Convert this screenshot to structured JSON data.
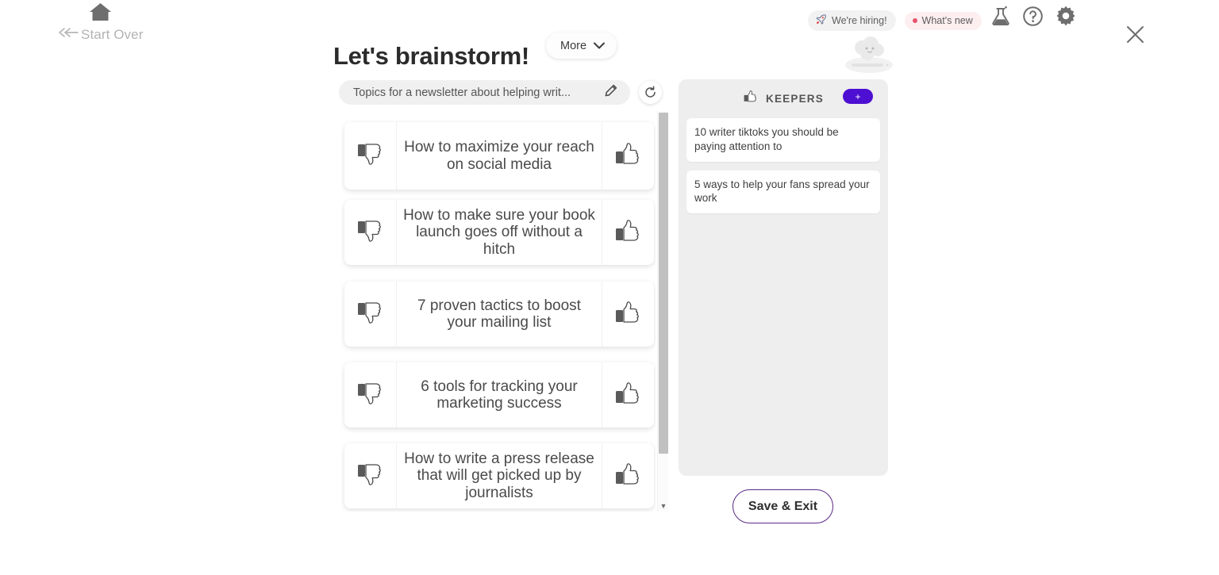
{
  "header": {
    "start_over_label": "Start Over",
    "home_icon": "home-icon",
    "back_icon": "double-chevron-left-icon",
    "badges": [
      {
        "label": "We're hiring!",
        "icon": "rocket-icon"
      },
      {
        "label": "What's new",
        "icon": "red-dot-icon"
      }
    ],
    "icons": [
      {
        "name": "flask-icon",
        "title": "Labs"
      },
      {
        "name": "question-circle-icon",
        "title": "Help"
      },
      {
        "name": "gear-icon",
        "title": "Settings"
      }
    ],
    "close_icon": "close-icon",
    "mascot": "cloud-mascot"
  },
  "main": {
    "title": "Let's brainstorm!",
    "more_button": {
      "label": "More",
      "icon": "chevron-down-icon"
    },
    "topic_input": {
      "value": "Topics for a newsletter about helping writ...",
      "placeholder": "Topics for a newsletter about helping writ...",
      "edit_icon": "pencil-icon"
    },
    "refresh_icon": "refresh-icon",
    "ideas": [
      {
        "text": "How to maximize your reach on social media",
        "reject_icon": "thumbs-down-icon",
        "accept_icon": "thumbs-up-icon"
      },
      {
        "text": "How to make sure your book launch goes off without a hitch",
        "reject_icon": "thumbs-down-icon",
        "accept_icon": "thumbs-up-icon"
      },
      {
        "text": "7 proven tactics to boost your mailing list",
        "reject_icon": "thumbs-down-icon",
        "accept_icon": "thumbs-up-icon"
      },
      {
        "text": "6 tools for tracking your marketing success",
        "reject_icon": "thumbs-down-icon",
        "accept_icon": "thumbs-up-icon"
      },
      {
        "text": "How to write a press release that will get picked up by journalists",
        "reject_icon": "thumbs-down-icon",
        "accept_icon": "thumbs-up-icon"
      }
    ],
    "scrollbar": {
      "down_arrow": "▼"
    }
  },
  "keepers": {
    "title": "KEEPERS",
    "icon": "thumbs-up-icon",
    "add_label": "+",
    "items": [
      {
        "text": "10 writer tiktoks you should be paying attention to"
      },
      {
        "text": "5 ways to help your fans spread your work"
      }
    ]
  },
  "footer": {
    "save_exit_label": "Save & Exit"
  },
  "colors": {
    "accent_purple": "#4d0fd2",
    "save_border": "#5b2a86",
    "whats_new_bg": "#fdeef0",
    "whats_new_dot": "#e4536b",
    "hiring_bg": "#f2f2f2",
    "keepers_bg": "#eeeeee",
    "input_bg": "#f0f0f0",
    "scroll_thumb": "#c0c0c0"
  }
}
